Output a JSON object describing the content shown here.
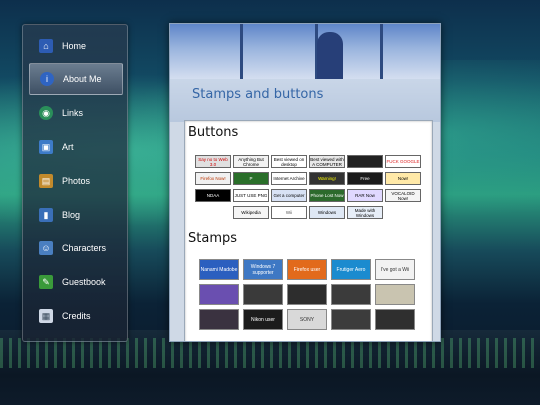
{
  "sidebar": {
    "items": [
      {
        "label": "Home",
        "icon": "home-icon"
      },
      {
        "label": "About Me",
        "icon": "info-icon"
      },
      {
        "label": "Links",
        "icon": "globe-icon"
      },
      {
        "label": "Art",
        "icon": "monitor-icon"
      },
      {
        "label": "Photos",
        "icon": "photos-icon"
      },
      {
        "label": "Blog",
        "icon": "book-icon"
      },
      {
        "label": "Characters",
        "icon": "people-icon"
      },
      {
        "label": "Guestbook",
        "icon": "guestbook-icon"
      },
      {
        "label": "Credits",
        "icon": "credits-icon"
      }
    ],
    "active": "About Me"
  },
  "page": {
    "title": "Stamps and buttons",
    "buttons_heading": "Buttons",
    "stamps_heading": "Stamps"
  },
  "buttons": [
    {
      "text": "Say no to Web 3.0",
      "bg": "#e0e0e0",
      "fg": "#c00"
    },
    {
      "text": "Anything But Chrome",
      "bg": "#f2f2f2",
      "fg": "#000"
    },
    {
      "text": "Best viewed on desktop",
      "bg": "#ffffff",
      "fg": "#000"
    },
    {
      "text": "Best viewed with A COMPUTER",
      "bg": "#e8e8e8",
      "fg": "#000"
    },
    {
      "text": "",
      "bg": "#222",
      "fg": "#fff"
    },
    {
      "text": "FUCK GOOGLE",
      "bg": "#ffffff",
      "fg": "#d22"
    },
    {
      "text": "Firefox Now!",
      "bg": "#f0f0f0",
      "fg": "#b30"
    },
    {
      "text": "P",
      "bg": "#2a6f2a",
      "fg": "#fff"
    },
    {
      "text": "Internet Archive",
      "bg": "#ffffff",
      "fg": "#000"
    },
    {
      "text": "Warning!",
      "bg": "#333",
      "fg": "#ff0"
    },
    {
      "text": "Free",
      "bg": "#1b1b1b",
      "fg": "#fff"
    },
    {
      "text": "Now!",
      "bg": "#ffe9a8",
      "fg": "#000"
    },
    {
      "text": "NDAA",
      "bg": "#000",
      "fg": "#fff"
    },
    {
      "text": "JUST USE PNG",
      "bg": "#ffffff",
      "fg": "#000"
    },
    {
      "text": "Get a computer",
      "bg": "#d8e2f5",
      "fg": "#000"
    },
    {
      "text": "Phone Lost Now",
      "bg": "#2c6a2c",
      "fg": "#fff"
    },
    {
      "text": "RAR Now",
      "bg": "#e0d8ff",
      "fg": "#000"
    },
    {
      "text": "VOCALOID Now!",
      "bg": "#f4f4f4",
      "fg": "#000"
    },
    {
      "text": "Wikipedia",
      "bg": "#f5f5f5",
      "fg": "#000"
    },
    {
      "text": "Wii",
      "bg": "#ffffff",
      "fg": "#555"
    },
    {
      "text": "Windows",
      "bg": "#dfe8f5",
      "fg": "#000"
    },
    {
      "text": "Made with Windows",
      "bg": "#e7eef8",
      "fg": "#000"
    }
  ],
  "stamps": [
    {
      "text": "Nanami Madobe",
      "bg": "#2b5fbf"
    },
    {
      "text": "Windows 7 supporter",
      "bg": "#3e78c4"
    },
    {
      "text": "Firefox user",
      "bg": "#e26a1b"
    },
    {
      "text": "Frutiger Aero",
      "bg": "#1b8bcf"
    },
    {
      "text": "I've got a Wii",
      "bg": "#f2f2f2"
    },
    {
      "text": "",
      "bg": "#6a4fb0"
    },
    {
      "text": "",
      "bg": "#3a3a3a"
    },
    {
      "text": "",
      "bg": "#2d2d2d"
    },
    {
      "text": "",
      "bg": "#3b3b3b"
    },
    {
      "text": "",
      "bg": "#c9c4b0"
    },
    {
      "text": "",
      "bg": "#3a3240"
    },
    {
      "text": "Nikon user",
      "bg": "#1c1c1c"
    },
    {
      "text": "SONY",
      "bg": "#d9d9d9"
    },
    {
      "text": "",
      "bg": "#3c3c3c"
    },
    {
      "text": "",
      "bg": "#2f2f2f"
    }
  ]
}
